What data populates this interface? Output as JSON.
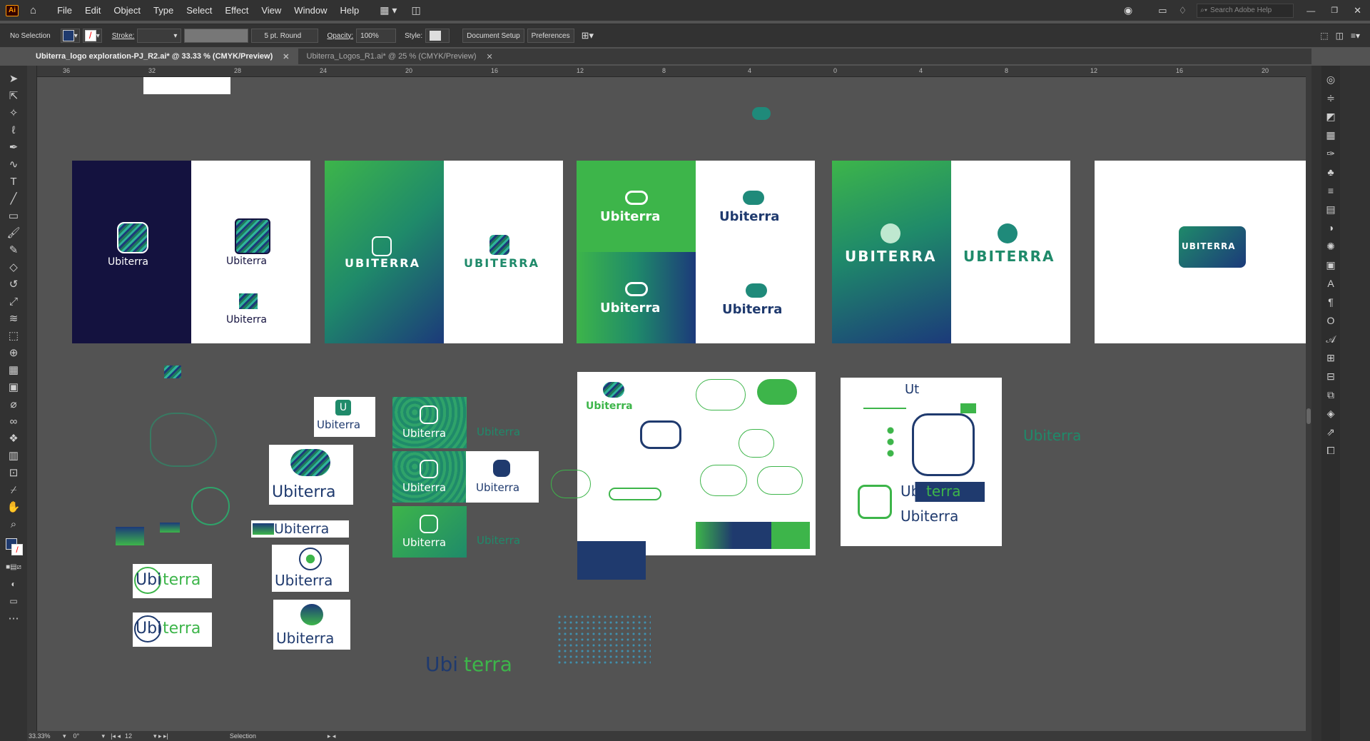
{
  "app": {
    "logo": "Ai"
  },
  "menu": [
    "File",
    "Edit",
    "Object",
    "Type",
    "Select",
    "Effect",
    "View",
    "Window",
    "Help"
  ],
  "search_placeholder": "Search Adobe Help",
  "options": {
    "selection": "No Selection",
    "stroke_label": "Stroke:",
    "brush": "5 pt. Round",
    "opacity_label": "Opacity:",
    "opacity_value": "100%",
    "style_label": "Style:",
    "doc_setup": "Document Setup",
    "preferences": "Preferences"
  },
  "tabs": [
    {
      "label": "Ubiterra_logo exploration-PJ_R2.ai* @ 33.33 % (CMYK/Preview)"
    },
    {
      "label": "Ubiterra_Logos_R1.ai* @ 25 % (CMYK/Preview)"
    }
  ],
  "ruler_h": [
    "36",
    "32",
    "28",
    "24",
    "20",
    "16",
    "12",
    "8",
    "4",
    "0",
    "4",
    "8",
    "12",
    "16",
    "20"
  ],
  "status": {
    "zoom": "33.33%",
    "rotate": "0°",
    "artboard": "12",
    "tool": "Selection"
  },
  "artwork": {
    "brand": "Ubiterra",
    "brand_upper": "UBITERRA",
    "brand_prefix": "Ubi",
    "brand_suffix": "terra",
    "monogram": "Ut",
    "letter_u": "U"
  },
  "colors": {
    "navy": "#14123f",
    "green": "#3db54a",
    "teal": "#1f8a6a",
    "blue": "#1f3a6e"
  }
}
